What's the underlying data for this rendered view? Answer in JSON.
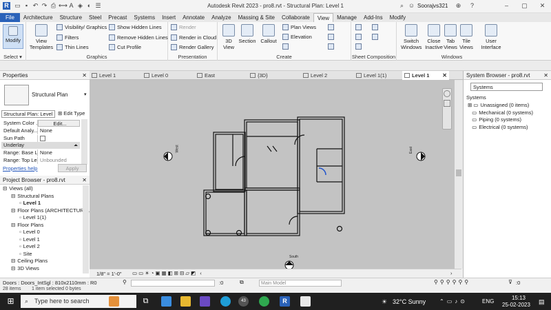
{
  "titlebar": {
    "title": "Autodesk Revit 2023 - pro8.rvt - Structural Plan: Level 1",
    "user": "Soorajvs321"
  },
  "ribbon_tabs": [
    "File",
    "Architecture",
    "Structure",
    "Steel",
    "Precast",
    "Systems",
    "Insert",
    "Annotate",
    "Analyze",
    "Massing & Site",
    "Collaborate",
    "View",
    "Manage",
    "Add-Ins",
    "Modify"
  ],
  "active_tab": "View",
  "ribbon": {
    "select": {
      "modify": "Modify",
      "label": "Select ▾"
    },
    "graphics": {
      "view_templates": "View Templates",
      "visibility": "Visibility/ Graphics",
      "filters": "Filters",
      "thin_lines": "Thin Lines",
      "show_hidden": "Show Hidden Lines",
      "remove_hidden": "Remove Hidden Lines",
      "cut_profile": "Cut Profile",
      "label": "Graphics"
    },
    "presentation": {
      "render": "Render",
      "render_cloud": "Render in Cloud",
      "render_gallery": "Render Gallery",
      "label": "Presentation"
    },
    "create": {
      "view3d": "3D View",
      "section": "Section",
      "callout": "Callout",
      "plan_views": "Plan Views",
      "elevation": "Elevation",
      "label": "Create"
    },
    "sheet_composition": {
      "label": "Sheet Composition"
    },
    "windows": {
      "switch": "Switch Windows",
      "close_inactive": "Close Inactive",
      "tab_views": "Tab Views",
      "tile_views": "Tile Views",
      "user_interface": "User Interface",
      "label": "Windows"
    }
  },
  "view_tabs": [
    "Level 1",
    "Level 0",
    "East",
    "{3D}",
    "Level 2",
    "Level 1(1)",
    "Level 1"
  ],
  "properties": {
    "title": "Properties",
    "type_name": "Structural Plan",
    "selector": "Structural Plan: Level",
    "edit_type": "Edit Type",
    "rows": [
      {
        "k": "System Color ...",
        "v": "Edit..."
      },
      {
        "k": "Default Analy...",
        "v": "None"
      },
      {
        "k": "Sun Path",
        "v": ""
      }
    ],
    "underlay_header": "Underlay",
    "underlay_rows": [
      {
        "k": "Range: Base L...",
        "v": "None"
      },
      {
        "k": "Range: Top Le...",
        "v": "Unbounded"
      }
    ],
    "help": "Properties help",
    "apply": "Apply"
  },
  "project_browser": {
    "title": "Project Browser - pro8.rvt",
    "items": [
      {
        "label": "Views (all)",
        "indent": 0
      },
      {
        "label": "Structural Plans",
        "indent": 1
      },
      {
        "label": "Level 1",
        "indent": 2,
        "bold": true
      },
      {
        "label": "Floor Plans (ARCHITECTURAL",
        "indent": 1
      },
      {
        "label": "Level 1(1)",
        "indent": 2
      },
      {
        "label": "Floor Plans",
        "indent": 1
      },
      {
        "label": "Level 0",
        "indent": 2
      },
      {
        "label": "Level 1",
        "indent": 2
      },
      {
        "label": "Level 2",
        "indent": 2
      },
      {
        "label": "Site",
        "indent": 2
      },
      {
        "label": "Ceiling Plans",
        "indent": 1
      },
      {
        "label": "3D Views",
        "indent": 1
      }
    ]
  },
  "system_browser": {
    "title": "System Browser - pro8.rvt",
    "dropdown": "Systems",
    "header": "Systems",
    "items": [
      "Unassigned (0 items)",
      "Mechanical (0 systems)",
      "Piping (0 systems)",
      "Electrical (0 systems)"
    ]
  },
  "drawing": {
    "west": "West",
    "east": "East",
    "south": "South"
  },
  "view_control": {
    "scale": "1/8\" = 1'-0\""
  },
  "status": {
    "selection": "Doors : Doors_IntSgl : 810x2110mm : R0",
    "items": "28 items",
    "selected": "1 item selected 0 bytes",
    "zero": ":0",
    "model": "Main Model",
    "filter_count": ":0"
  },
  "taskbar": {
    "search_placeholder": "Type here to search",
    "weather": "32°C  Sunny",
    "lang": "ENG",
    "time": "15:13",
    "date": "25-02-2023",
    "badge": "43"
  }
}
